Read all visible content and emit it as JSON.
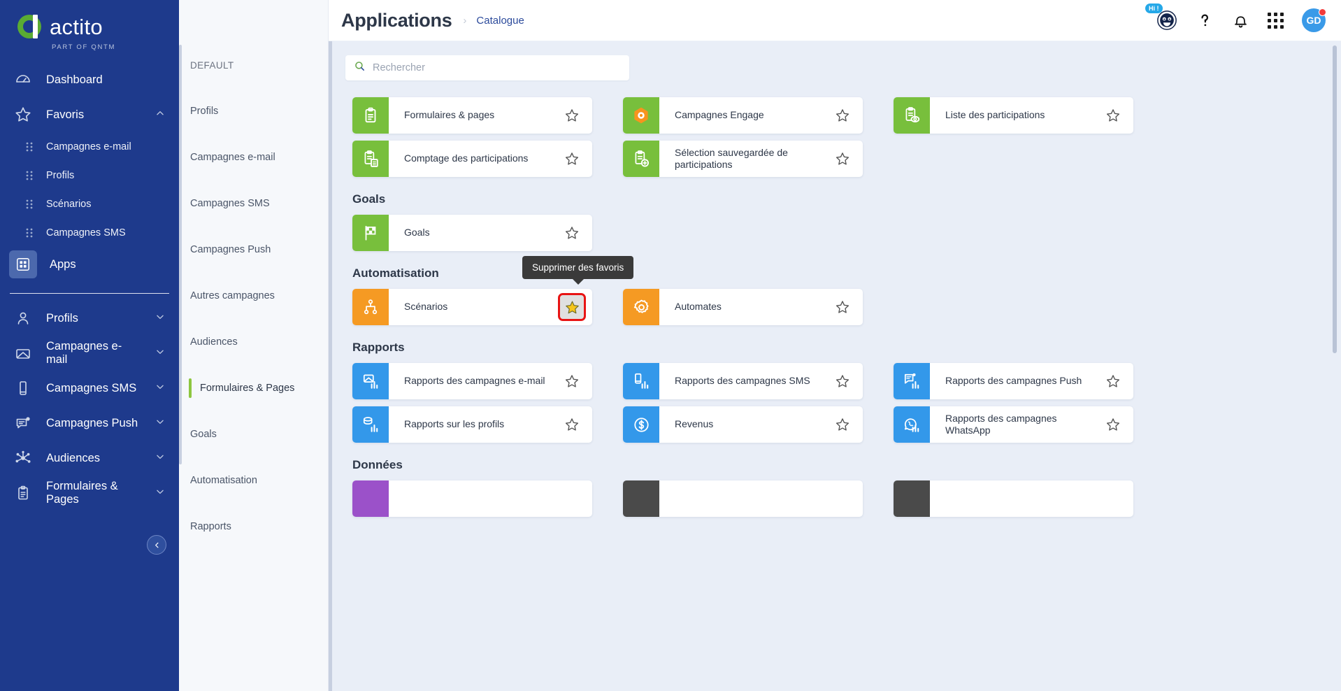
{
  "brand": {
    "name": "actito",
    "tagline": "PART OF QNTM",
    "green": "#5aab33",
    "blue": "#1e3a8c"
  },
  "sidebar": {
    "items": [
      {
        "label": "Dashboard",
        "icon": "dashboard-icon",
        "type": "item"
      },
      {
        "label": "Favoris",
        "icon": "star-icon",
        "type": "item",
        "chevron": "up"
      },
      {
        "label": "Campagnes e-mail",
        "icon": "drag-handle-icon",
        "type": "sub"
      },
      {
        "label": "Profils",
        "icon": "drag-handle-icon",
        "type": "sub"
      },
      {
        "label": "Scénarios",
        "icon": "drag-handle-icon",
        "type": "sub"
      },
      {
        "label": "Campagnes SMS",
        "icon": "drag-handle-icon",
        "type": "sub"
      },
      {
        "label": "Apps",
        "icon": "apps-grid-icon",
        "type": "item",
        "active": true
      }
    ],
    "items2": [
      {
        "label": "Profils",
        "icon": "user-icon",
        "chevron": "down"
      },
      {
        "label": "Campagnes e-mail",
        "icon": "envelope-icon",
        "chevron": "down"
      },
      {
        "label": "Campagnes SMS",
        "icon": "mobile-icon",
        "chevron": "down"
      },
      {
        "label": "Campagnes Push",
        "icon": "push-message-icon",
        "chevron": "down"
      },
      {
        "label": "Audiences",
        "icon": "network-nodes-icon",
        "chevron": "down"
      },
      {
        "label": "Formulaires & Pages",
        "icon": "clipboard-icon",
        "chevron": "down"
      }
    ],
    "collapse_icon": "chevron-left-icon"
  },
  "categories": {
    "header": "DEFAULT",
    "items": [
      {
        "label": "Profils"
      },
      {
        "label": "Campagnes e-mail"
      },
      {
        "label": "Campagnes SMS"
      },
      {
        "label": "Campagnes Push"
      },
      {
        "label": "Autres campagnes"
      },
      {
        "label": "Audiences"
      },
      {
        "label": "Formulaires & Pages",
        "selected": true
      },
      {
        "label": "Goals"
      },
      {
        "label": "Automatisation"
      },
      {
        "label": "Rapports"
      }
    ]
  },
  "header": {
    "title": "Applications",
    "breadcrumb_separator": "›",
    "breadcrumb": "Catalogue",
    "chatbot_badge": "Hi !",
    "chatbot_icon": "chatbot-face-icon",
    "help_icon": "question-mark-icon",
    "notifications_icon": "bell-icon",
    "apps_icon": "grid-dots-icon",
    "avatar_initials": "GD"
  },
  "search": {
    "placeholder": "Rechercher",
    "value": "",
    "icon": "search-icon"
  },
  "tooltip": {
    "text": "Supprimer des favoris"
  },
  "sections": [
    {
      "title": "",
      "cards": [
        {
          "label": "Formulaires & pages",
          "icon": "clipboard-icon",
          "color": "#78bf3c",
          "fav": false
        },
        {
          "label": "Campagnes Engage",
          "icon": "hexagon-engage-icon",
          "color": "#78bf3c",
          "fav": false
        },
        {
          "label": "Liste des participations",
          "icon": "clipboard-eye-icon",
          "color": "#78bf3c",
          "fav": false
        },
        {
          "label": "Comptage des participations",
          "icon": "clipboard-calc-icon",
          "color": "#78bf3c",
          "fav": false
        },
        {
          "label": "Sélection sauvegardée de participations",
          "icon": "clipboard-plus-icon",
          "color": "#78bf3c",
          "fav": false
        }
      ]
    },
    {
      "title": "Goals",
      "cards": [
        {
          "label": "Goals",
          "icon": "checkered-flag-icon",
          "color": "#78bf3c",
          "fav": false
        }
      ]
    },
    {
      "title": "Automatisation",
      "cards": [
        {
          "label": "Scénarios",
          "icon": "scenario-tree-icon",
          "color": "#f59a23",
          "fav": true,
          "highlighted": true
        },
        {
          "label": "Automates",
          "icon": "gear-icon",
          "color": "#f59a23",
          "fav": false
        }
      ]
    },
    {
      "title": "Rapports",
      "cards": [
        {
          "label": "Rapports des campagnes e-mail",
          "icon": "report-email-icon",
          "color": "#3398ea",
          "fav": false
        },
        {
          "label": "Rapports des campagnes SMS",
          "icon": "report-sms-icon",
          "color": "#3398ea",
          "fav": false
        },
        {
          "label": "Rapports des campagnes Push",
          "icon": "report-push-icon",
          "color": "#3398ea",
          "fav": false
        },
        {
          "label": "Rapports sur les profils",
          "icon": "report-profiles-icon",
          "color": "#3398ea",
          "fav": false
        },
        {
          "label": "Revenus",
          "icon": "dollar-icon",
          "color": "#3398ea",
          "fav": false
        },
        {
          "label": "Rapports des campagnes WhatsApp",
          "icon": "report-whatsapp-icon",
          "color": "#3398ea",
          "fav": false
        }
      ]
    },
    {
      "title": "Données",
      "cards": [
        {
          "label": "",
          "icon": "",
          "color": "#9b51c9",
          "fav": false
        },
        {
          "label": "",
          "icon": "",
          "color": "#4a4a4a",
          "fav": false
        },
        {
          "label": "",
          "icon": "",
          "color": "#4a4a4a",
          "fav": false
        }
      ]
    }
  ]
}
